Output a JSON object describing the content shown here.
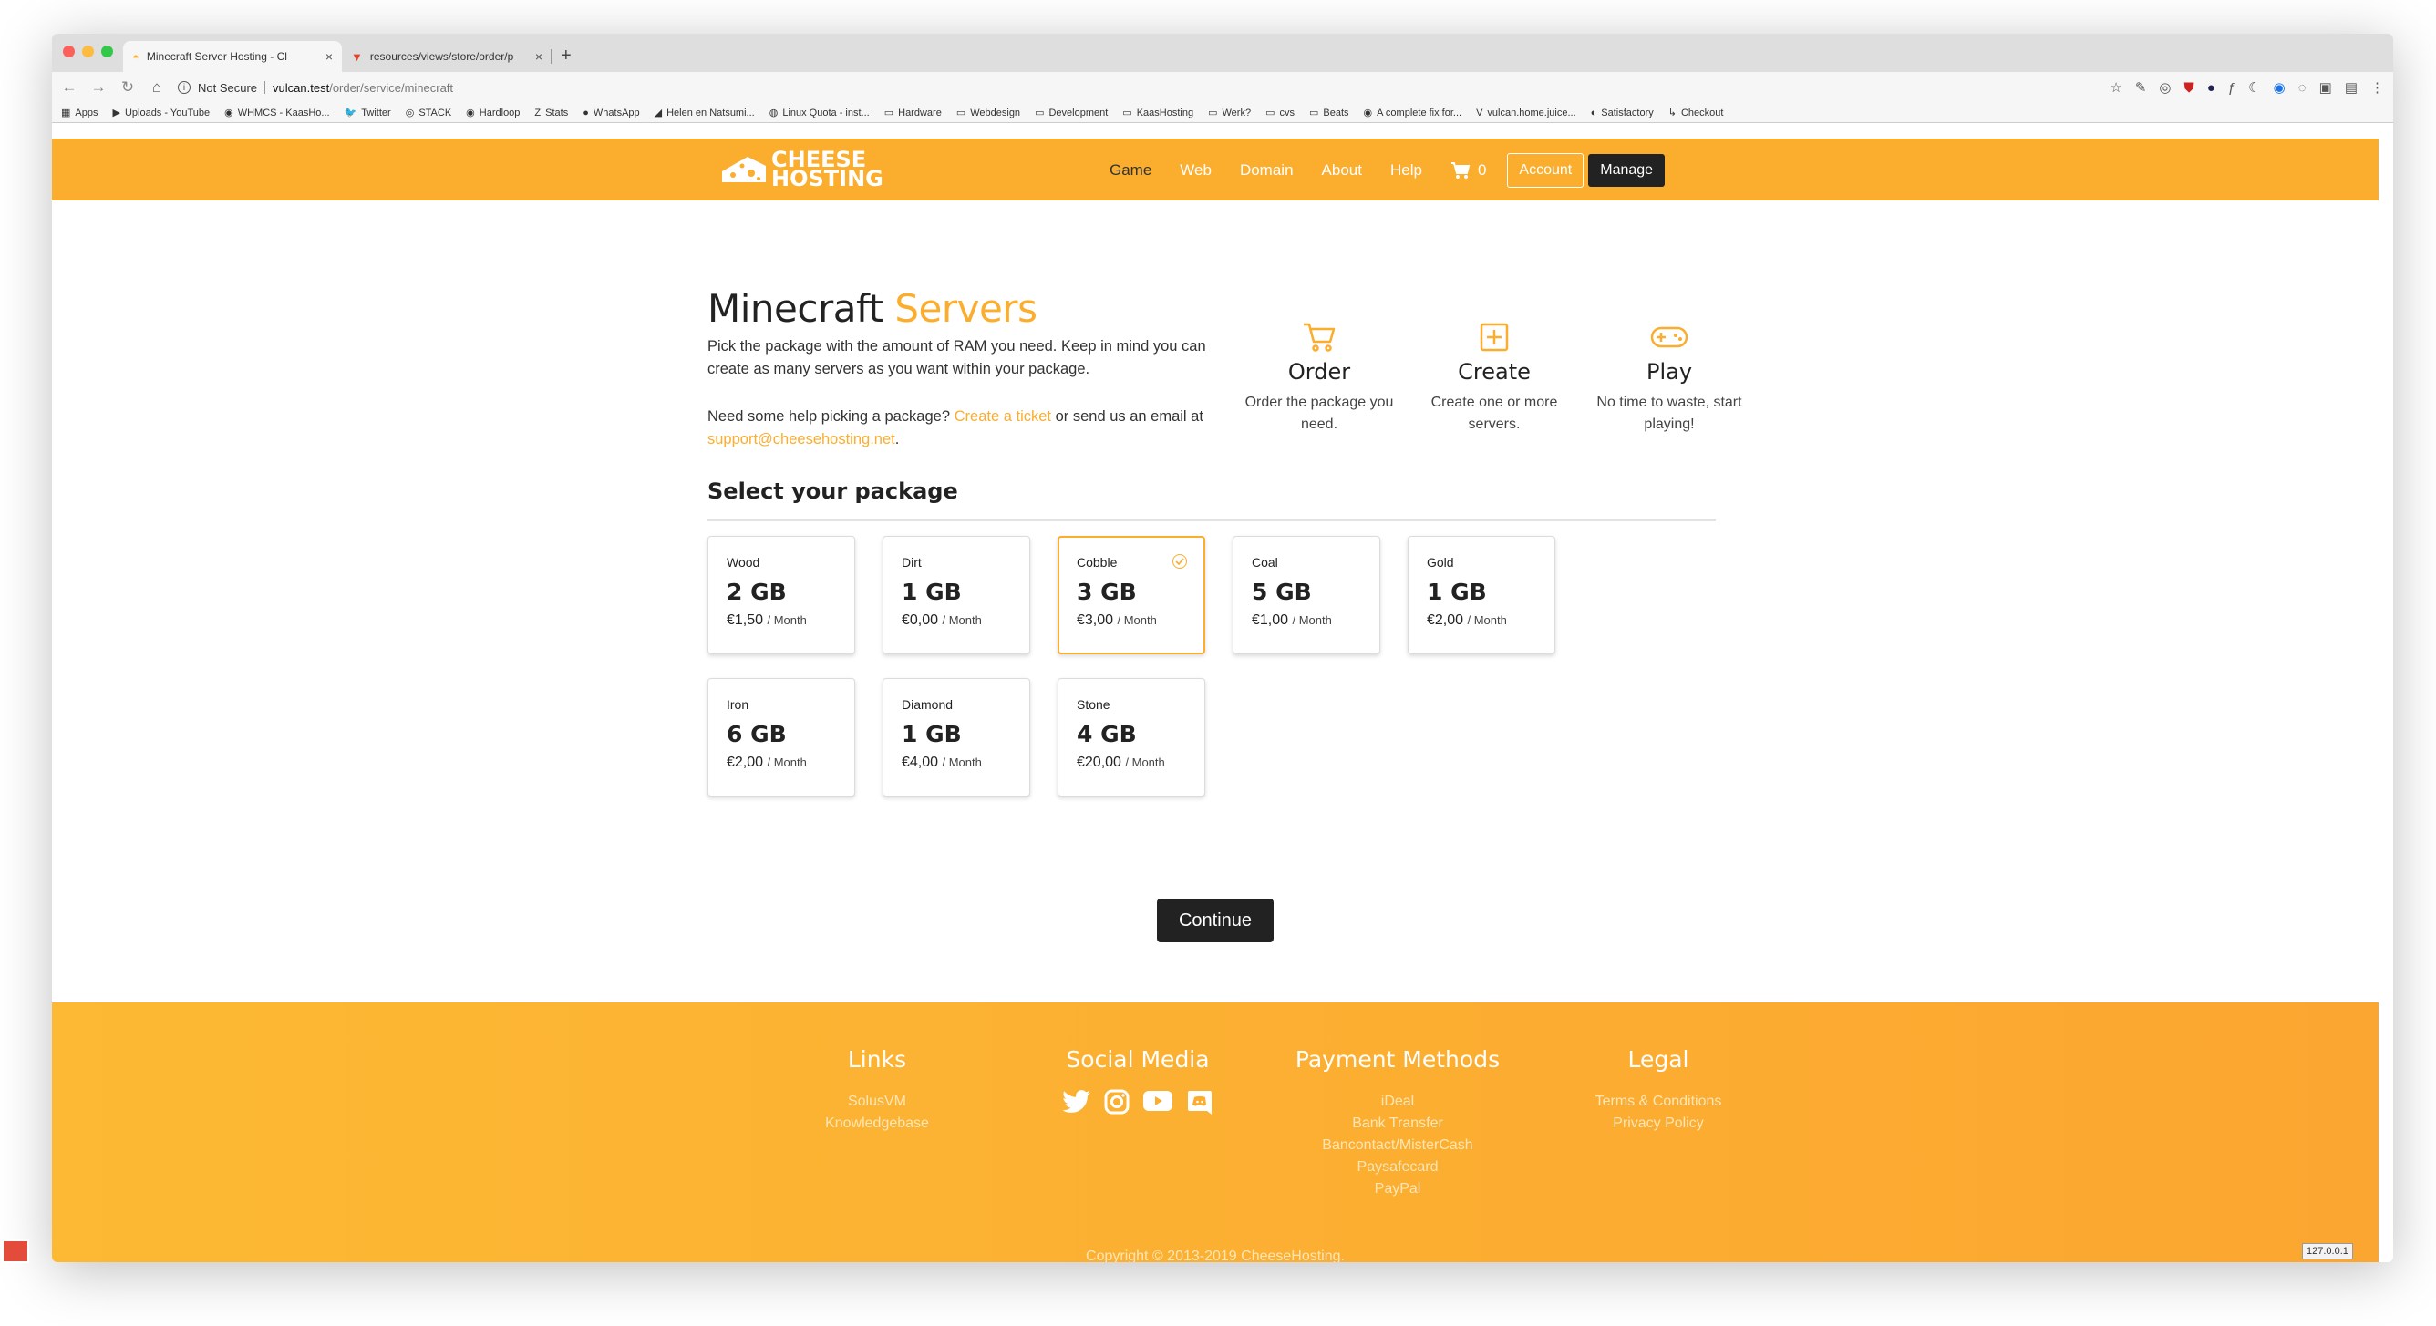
{
  "browser": {
    "tabs": [
      {
        "title": "Minecraft Server Hosting - Cl",
        "active": true
      },
      {
        "title": "resources/views/store/order/p",
        "active": false
      }
    ],
    "new_tab": "+",
    "close": "×",
    "not_secure": "Not Secure",
    "url_host": "vulcan.test",
    "url_path": "/order/service/minecraft",
    "bookmarks": [
      "Apps",
      "Uploads - YouTube",
      "WHMCS - KaasHo...",
      "Twitter",
      "STACK",
      "Hardloop",
      "Stats",
      "WhatsApp",
      "Helen en Natsumi...",
      "Linux Quota - inst...",
      "Hardware",
      "Webdesign",
      "Development",
      "KaasHosting",
      "Werk?",
      "cvs",
      "Beats",
      "A complete fix for...",
      "vulcan.home.juice...",
      "Satisfactory",
      "Checkout"
    ]
  },
  "nav": {
    "logo_line1": "CHEESE",
    "logo_line2": "HOSTING",
    "items": [
      "Game",
      "Web",
      "Domain",
      "About",
      "Help"
    ],
    "cart_count": "0",
    "account": "Account",
    "manage": "Manage"
  },
  "hero": {
    "title_main": "Minecraft",
    "title_accent": "Servers",
    "p1": "Pick the package with the amount of RAM you need. Keep in mind you can create as many servers as you want within your package.",
    "p2_a": "Need some help picking a package?",
    "p2_link1": "Create a ticket",
    "p2_b": "or send us an email at",
    "p2_link2": "support@cheesehosting.net",
    "p2_c": "."
  },
  "steps": [
    {
      "title": "Order",
      "desc": "Order the package you need.",
      "icon": "cart-icon"
    },
    {
      "title": "Create",
      "desc": "Create one or more servers.",
      "icon": "plus-square-icon"
    },
    {
      "title": "Play",
      "desc": "No time to waste, start playing!",
      "icon": "gamepad-icon"
    }
  ],
  "select_title": "Select your package",
  "per_month": "/ Month",
  "packages": [
    {
      "name": "Wood",
      "ram": "2 GB",
      "price": "€1,50",
      "selected": false
    },
    {
      "name": "Dirt",
      "ram": "1 GB",
      "price": "€0,00",
      "selected": false
    },
    {
      "name": "Cobble",
      "ram": "3 GB",
      "price": "€3,00",
      "selected": true
    },
    {
      "name": "Coal",
      "ram": "5 GB",
      "price": "€1,00",
      "selected": false
    },
    {
      "name": "Gold",
      "ram": "1 GB",
      "price": "€2,00",
      "selected": false
    },
    {
      "name": "Iron",
      "ram": "6 GB",
      "price": "€2,00",
      "selected": false
    },
    {
      "name": "Diamond",
      "ram": "1 GB",
      "price": "€4,00",
      "selected": false
    },
    {
      "name": "Stone",
      "ram": "4 GB",
      "price": "€20,00",
      "selected": false
    }
  ],
  "continue": "Continue",
  "footer": {
    "links_title": "Links",
    "links": [
      "SolusVM",
      "Knowledgebase"
    ],
    "social_title": "Social Media",
    "payment_title": "Payment Methods",
    "payments": [
      "iDeal",
      "Bank Transfer",
      "Bancontact/MisterCash",
      "Paysafecard",
      "PayPal"
    ],
    "legal_title": "Legal",
    "legal": [
      "Terms & Conditions",
      "Privacy Policy"
    ],
    "copyright": "Copyright © 2013-2019 CheeseHosting."
  },
  "ip_badge": "127.0.0.1",
  "colors": {
    "brand": "#fbad2e",
    "dark": "#222222"
  }
}
